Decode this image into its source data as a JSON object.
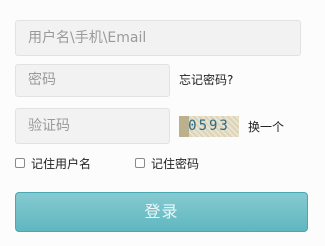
{
  "form": {
    "username_placeholder": "用户名\\手机\\Email",
    "password_placeholder": "密码",
    "forgot_password_label": "忘记密码?",
    "captcha_placeholder": "验证码",
    "captcha_code": "0593",
    "refresh_captcha_label": "换一个",
    "remember_username_label": "记住用户名",
    "remember_password_label": "记住密码",
    "login_button_label": "登录"
  }
}
